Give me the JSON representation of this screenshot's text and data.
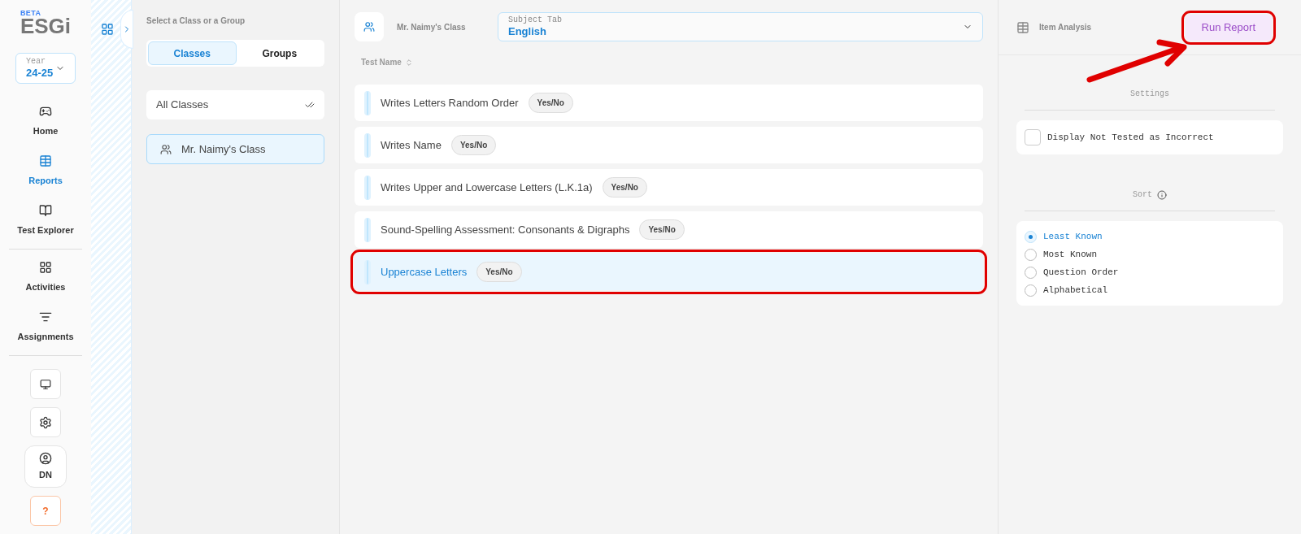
{
  "logo": {
    "beta": "BETA",
    "name": "ESGi"
  },
  "year": {
    "label": "Year",
    "value": "24-25"
  },
  "nav": [
    {
      "label": "Home",
      "kind": "home",
      "selected": false
    },
    {
      "label": "Reports",
      "kind": "reports",
      "selected": true
    },
    {
      "label": "Test Explorer",
      "kind": "explorer",
      "selected": false
    },
    {
      "label": "Activities",
      "kind": "activities",
      "selected": false
    },
    {
      "label": "Assignments",
      "kind": "assignments",
      "selected": false
    }
  ],
  "user": {
    "initials": "DN"
  },
  "help": "?",
  "class_panel": {
    "title": "Select a Class or a Group",
    "tabs": [
      {
        "label": "Classes",
        "selected": true
      },
      {
        "label": "Groups",
        "selected": false
      }
    ],
    "all_classes": "All Classes",
    "classes": [
      {
        "label": "Mr. Naimy's Class",
        "selected": true
      }
    ]
  },
  "header": {
    "class_name": "Mr. Naimy's Class",
    "subject": {
      "label": "Subject Tab",
      "value": "English"
    }
  },
  "tests": {
    "column": "Test Name",
    "rows": [
      {
        "name": "Writes Letters Random Order",
        "type": "Yes/No",
        "selected": false
      },
      {
        "name": "Writes Name",
        "type": "Yes/No",
        "selected": false
      },
      {
        "name": "Writes Upper and Lowercase Letters (L.K.1a)",
        "type": "Yes/No",
        "selected": false
      },
      {
        "name": "Sound-Spelling Assessment: Consonants & Digraphs",
        "type": "Yes/No",
        "selected": false
      },
      {
        "name": "Uppercase Letters",
        "type": "Yes/No",
        "selected": true
      }
    ]
  },
  "right": {
    "title": "Item Analysis",
    "run": "Run Report",
    "settings": {
      "title": "Settings",
      "options": [
        {
          "label": "Display Not Tested as Incorrect",
          "checked": false
        }
      ]
    },
    "sort": {
      "title": "Sort",
      "options": [
        {
          "label": "Least Known",
          "selected": true
        },
        {
          "label": "Most Known",
          "selected": false
        },
        {
          "label": "Question Order",
          "selected": false
        },
        {
          "label": "Alphabetical",
          "selected": false
        }
      ]
    }
  }
}
